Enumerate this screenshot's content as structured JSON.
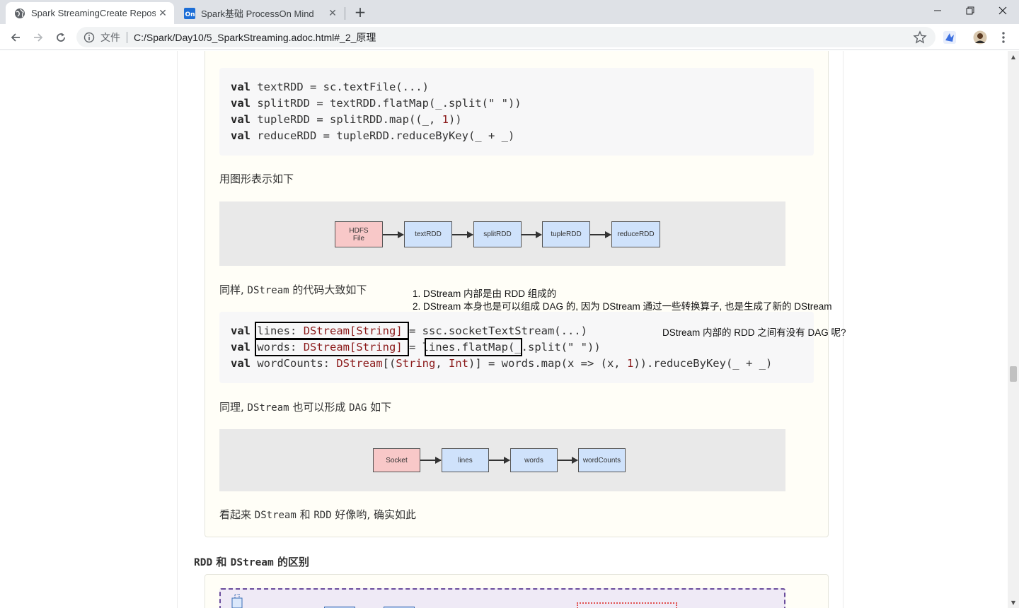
{
  "browser": {
    "tabs": [
      {
        "title": "Spark StreamingCreate Reposi",
        "active": true,
        "icon": "globe-icon"
      },
      {
        "title": "Spark基础 ProcessOn Mind",
        "active": false,
        "icon": "processon-icon"
      }
    ],
    "omnibox": {
      "scheme_label": "文件",
      "url": "C:/Spark/Day10/5_SparkStreaming.adoc.html#_2_原理"
    }
  },
  "document": {
    "code_block_1": {
      "lines": [
        {
          "kw": "val",
          "rest": " textRDD = sc.textFile(...)"
        },
        {
          "kw": "val",
          "rest": " splitRDD = textRDD.flatMap(_.split(\" \"))"
        },
        {
          "kw": "val",
          "rest": " tupleRDD = splitRDD.map((_, ",
          "num": "1",
          "tail": "))"
        },
        {
          "kw": "val",
          "rest": " reduceRDD = tupleRDD.reduceByKey(_ + _)"
        }
      ]
    },
    "para_graph_intro": "用图形表示如下",
    "diagram_1": {
      "nodes": [
        "HDFS\nFile",
        "textRDD",
        "splitRDD",
        "tupleRDD",
        "reduceRDD"
      ]
    },
    "para_dstream": {
      "pre": "同样, ",
      "code": "DStream",
      "post": " 的代码大致如下"
    },
    "annotations": {
      "note1": "1. DStream 内部是由 RDD 组成的",
      "note2": "2. DStream 本身也是可以组成 DAG 的, 因为 DStream 通过一些转换算子, 也是生成了新的 DStream",
      "question": "DStream 内部的 RDD 之间有没有 DAG 呢?"
    },
    "code_block_2": {
      "line1": {
        "kw": "val",
        "sp": " ",
        "name": "lines",
        "colon": ": ",
        "type": "DStream[String]",
        "rest": " = ssc.socketTextStream(...)"
      },
      "line2": {
        "kw": "val",
        "sp": " ",
        "name": "words",
        "colon": ": ",
        "type": "DStream[String]",
        "eq": " = ",
        "call": "lines.flatMap",
        "rest": "(_.split(\" \"))"
      },
      "line3": {
        "kw": "val",
        "pre": " wordCounts: ",
        "type": "DStream",
        "mid1": "[(",
        "t2": "String",
        "mid2": ", ",
        "t3": "Int",
        "mid3": ")] = words.map(x => (x, ",
        "num": "1",
        "rest": ")).reduceByKey(_ + _)"
      }
    },
    "para_dag": {
      "pre": "同理, ",
      "code": "DStream",
      "mid": " 也可以形成 ",
      "code2": "DAG",
      "post": " 如下"
    },
    "diagram_2": {
      "nodes": [
        "Socket",
        "lines",
        "words",
        "wordCounts"
      ]
    },
    "para_seems": {
      "pre": "看起来 ",
      "code": "DStream",
      "mid": " 和 ",
      "code2": "RDD",
      "post": " 好像哟, 确实如此"
    },
    "section_heading": {
      "code": "RDD",
      "mid": " 和 ",
      "code2": "DStream",
      "post": " 的区别"
    }
  },
  "colors": {
    "node_pink": "#f8c8c8",
    "node_blue": "#cfe2fb",
    "code_bg": "#f7f7f8",
    "sidebar_bg": "#fffef7",
    "type_color": "#8b1a1a"
  }
}
